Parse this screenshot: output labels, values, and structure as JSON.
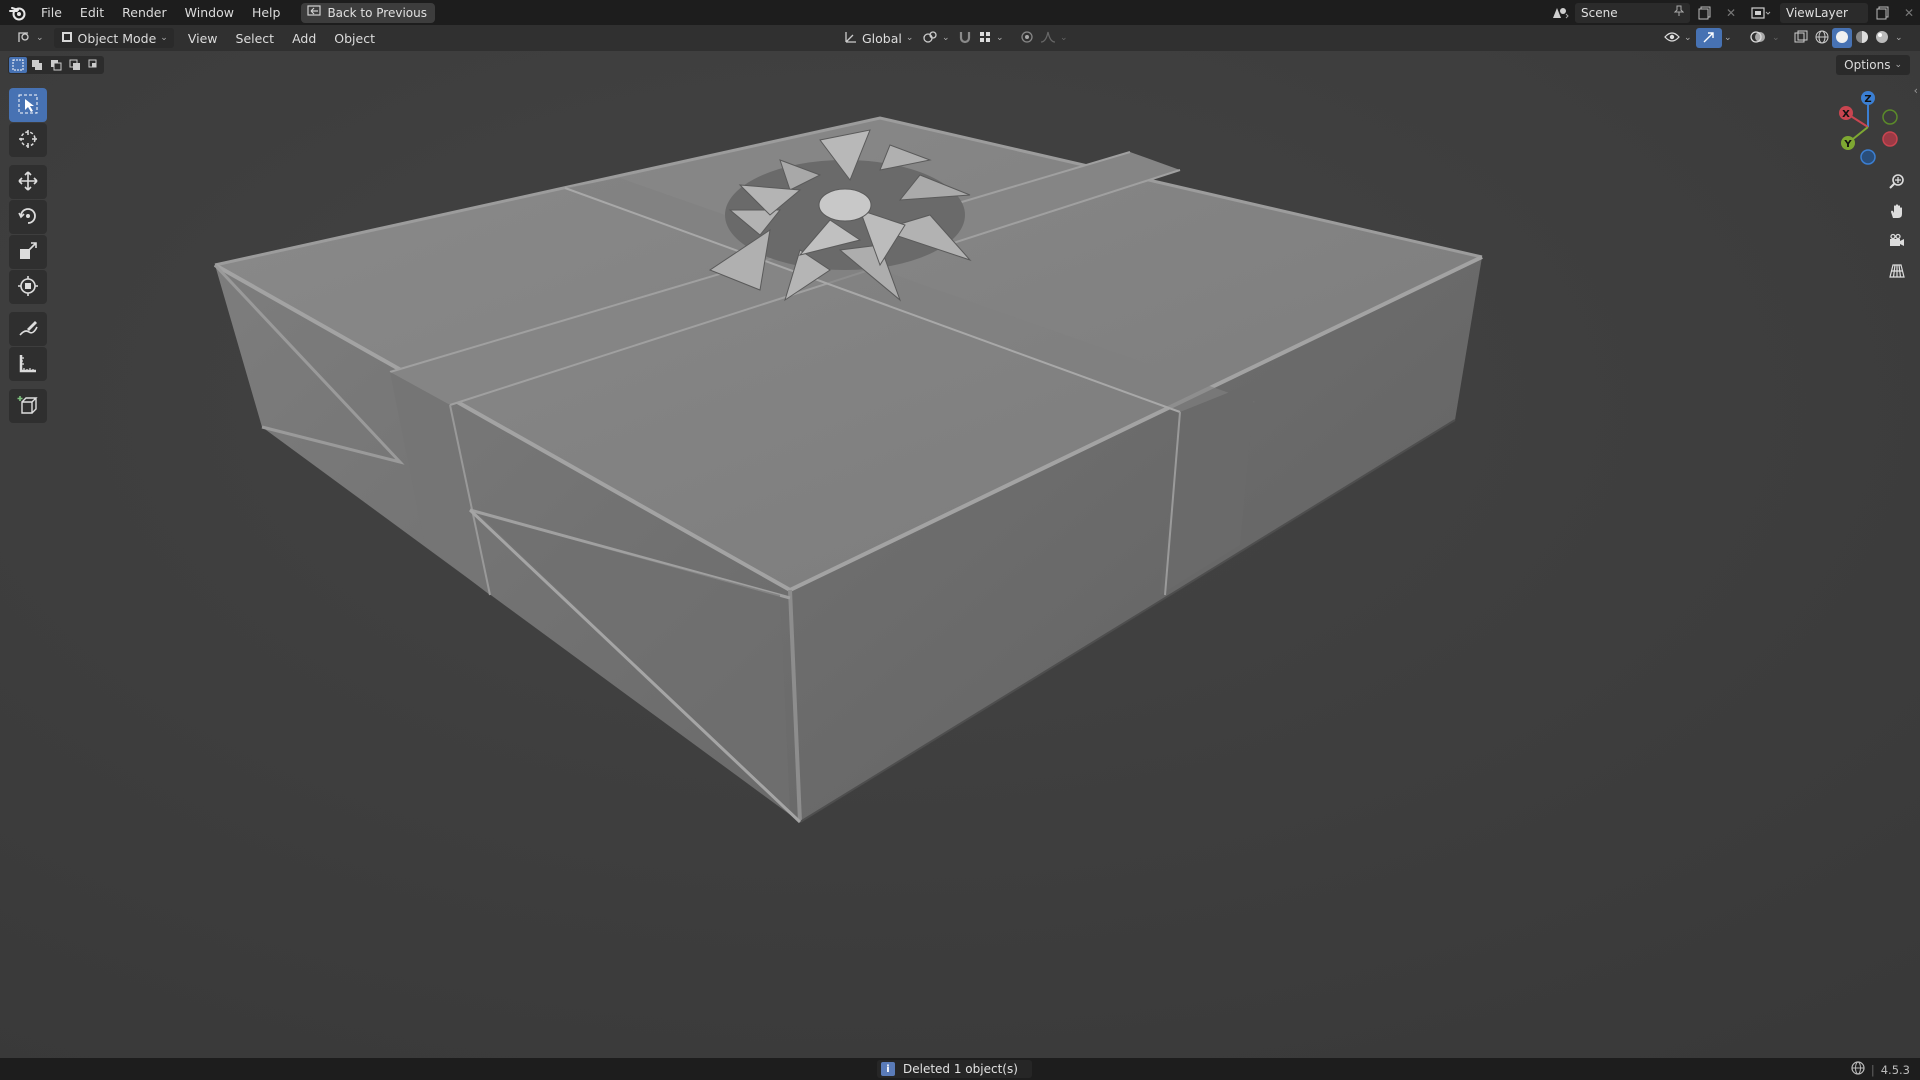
{
  "menu": {
    "items": [
      "File",
      "Edit",
      "Render",
      "Window",
      "Help"
    ],
    "back_button": "Back to Previous"
  },
  "top_right": {
    "scene_name": "Scene",
    "view_layer": "ViewLayer"
  },
  "header": {
    "mode": "Object Mode",
    "menus": [
      "View",
      "Select",
      "Add",
      "Object"
    ],
    "transform_orientation": "Global",
    "options_label": "Options"
  },
  "gizmo": {
    "x_label": "X",
    "y_label": "Y",
    "z_label": "Z"
  },
  "status": {
    "message": "Deleted 1 object(s)",
    "info_glyph": "i",
    "version": "4.5.3"
  },
  "colors": {
    "accent": "#4772b3",
    "x_axis": "#c94550",
    "y_axis": "#7ea832",
    "z_axis": "#3b7fd3",
    "viewport_bg": "#3d3d3d"
  },
  "icons": {
    "toolbar": [
      "select-box-icon",
      "cursor-icon",
      "move-icon",
      "rotate-icon",
      "scale-icon",
      "transform-icon",
      "annotate-icon",
      "measure-icon",
      "add-cube-icon"
    ],
    "navigation": [
      "zoom-icon",
      "pan-hand-icon",
      "camera-icon",
      "perspective-grid-icon"
    ]
  }
}
